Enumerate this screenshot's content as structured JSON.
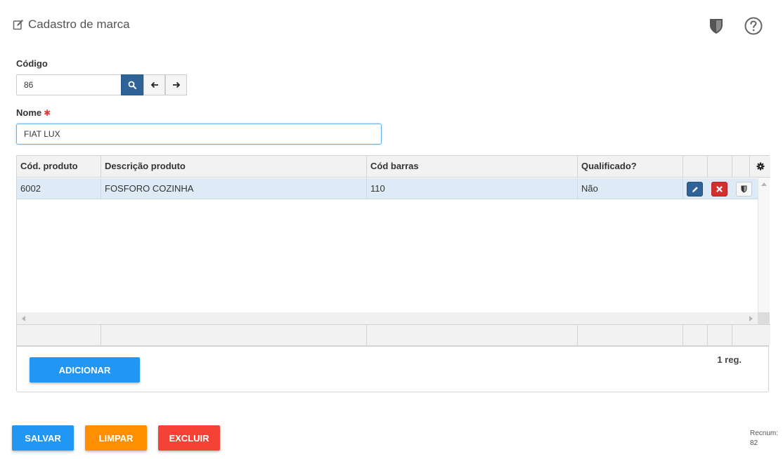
{
  "header": {
    "title": "Cadastro de marca"
  },
  "form": {
    "codigo_label": "Código",
    "codigo_value": "86",
    "nome_label": "Nome",
    "nome_required": "✱",
    "nome_value": "FIAT LUX"
  },
  "grid": {
    "columns": [
      "Cód. produto",
      "Descrição produto",
      "Cód barras",
      "Qualificado?"
    ],
    "rows": [
      {
        "cod": "6002",
        "descricao": "FOSFORO COZINHA",
        "barras": "110",
        "qualificado": "Não"
      }
    ]
  },
  "panel": {
    "add_label": "ADICIONAR",
    "count": "1 reg."
  },
  "actions": {
    "salvar": "SALVAR",
    "limpar": "LIMPAR",
    "excluir": "EXCLUIR"
  },
  "recnum": {
    "label": "Recnum:",
    "value": "82"
  },
  "colors": {
    "primary": "#2196f3",
    "search": "#2f6397",
    "orange": "#ff8f00",
    "danger": "#f44336",
    "row_selected": "#deeaf6"
  }
}
